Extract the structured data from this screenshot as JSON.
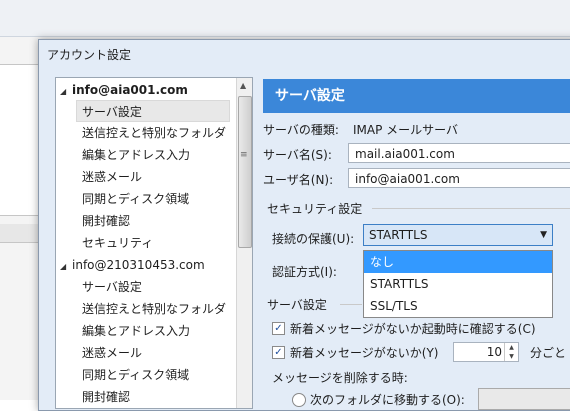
{
  "dialog": {
    "title": "アカウント設定"
  },
  "tree": {
    "accounts": [
      {
        "name": "info@aia001.com",
        "expander": "◢",
        "items": [
          "サーバ設定",
          "送信控えと特別なフォルダ",
          "編集とアドレス入力",
          "迷惑メール",
          "同期とディスク領域",
          "開封確認",
          "セキュリティ"
        ]
      },
      {
        "name": "info@210310453.com",
        "expander": "◢",
        "items": [
          "サーバ設定",
          "送信控えと特別なフォルダ",
          "編集とアドレス入力",
          "迷惑メール",
          "同期とディスク領域",
          "開封確認"
        ]
      }
    ],
    "scroll_grip": "≡"
  },
  "server": {
    "header": "サーバ設定",
    "type_label": "サーバの種類:",
    "type_value": "IMAP メールサーバ",
    "name_label": "サーバ名(S):",
    "name_value": "mail.aia001.com",
    "user_label": "ユーザ名(N):",
    "user_value": "info@aia001.com"
  },
  "security": {
    "section_label": "セキュリティ設定",
    "protect_label": "接続の保護(U):",
    "protect_value": "STARTTLS",
    "dropdown_options": [
      "なし",
      "STARTTLS",
      "SSL/TLS"
    ],
    "highlighted_option": "なし",
    "auth_label": "認証方式(I):"
  },
  "server_settings": {
    "section_label": "サーバ設定",
    "check1_label": "新着メッセージがないか起動時に確認する(C)",
    "check1_checked": true,
    "check2_label": "新着メッセージがないか(Y)",
    "check2_checked": true,
    "interval_value": "10",
    "interval_suffix": "分ごと",
    "delete_label": "メッセージを削除する時:",
    "move_label": "次のフォルダに移動する(O):"
  },
  "colors": {
    "accent": "#3b87d9",
    "highlight": "#3399ff"
  }
}
